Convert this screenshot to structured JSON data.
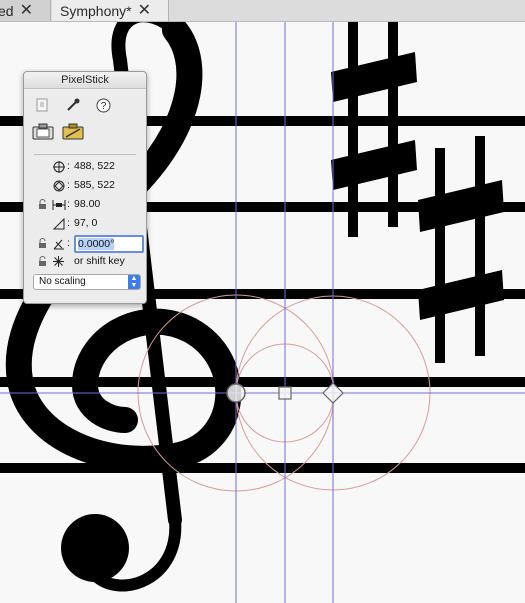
{
  "tabs": [
    {
      "label": "ed",
      "close_icon": "close-icon"
    },
    {
      "label": "Symphony*",
      "close_icon": "close-icon"
    }
  ],
  "panel": {
    "title": "PixelStick",
    "start_point": "488, 522",
    "end_point": "585, 522",
    "distance": "98.00",
    "delta": "97, 0",
    "angle": "0.0000°",
    "lock_hint": "or shift key",
    "scaling": "No scaling"
  },
  "colors": {
    "guide": "#6f6fd8",
    "circle": "#d89b9b",
    "notation": "#000000"
  }
}
